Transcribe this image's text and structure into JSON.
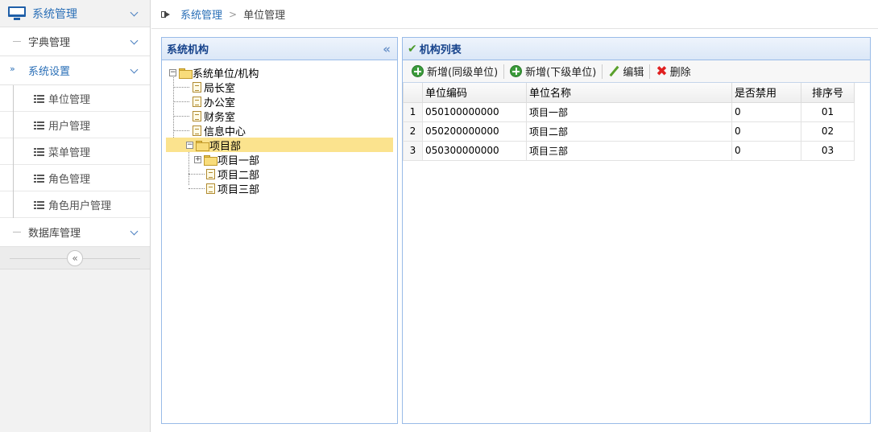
{
  "sidebar": {
    "header_label": "系统管理",
    "groups": [
      {
        "label": "字典管理"
      },
      {
        "label": "系统设置"
      },
      {
        "label": "数据库管理"
      }
    ],
    "items": [
      {
        "label": "单位管理"
      },
      {
        "label": "用户管理"
      },
      {
        "label": "菜单管理"
      },
      {
        "label": "角色管理"
      },
      {
        "label": "角色用户管理"
      }
    ],
    "collapse_glyph": "«",
    "active_marker": "»"
  },
  "breadcrumb": {
    "parent": "系统管理",
    "separator": ">",
    "current": "单位管理"
  },
  "tree_panel": {
    "title": "系统机构",
    "collapse_glyph": "«",
    "nodes": [
      {
        "label": "系统单位/机构",
        "level": 0,
        "type": "folder",
        "expander": "−"
      },
      {
        "label": "局长室",
        "level": 1,
        "type": "doc"
      },
      {
        "label": "办公室",
        "level": 1,
        "type": "doc"
      },
      {
        "label": "财务室",
        "level": 1,
        "type": "doc"
      },
      {
        "label": "信息中心",
        "level": 1,
        "type": "doc"
      },
      {
        "label": "项目部",
        "level": 1,
        "type": "folder",
        "expander": "−",
        "selected": true
      },
      {
        "label": "项目一部",
        "level": 2,
        "type": "folder",
        "expander": "+"
      },
      {
        "label": "项目二部",
        "level": 2,
        "type": "doc"
      },
      {
        "label": "项目三部",
        "level": 2,
        "type": "doc"
      }
    ]
  },
  "list_panel": {
    "title": "机构列表",
    "toolbar": {
      "add_sibling": "新增(同级单位)",
      "add_child": "新增(下级单位)",
      "edit": "编辑",
      "delete": "删除"
    },
    "columns": [
      "单位编码",
      "单位名称",
      "是否禁用",
      "排序号"
    ],
    "rows": [
      {
        "rn": "1",
        "code": "050100000000",
        "name": "项目一部",
        "disabled": "0",
        "order": "01"
      },
      {
        "rn": "2",
        "code": "050200000000",
        "name": "项目二部",
        "disabled": "0",
        "order": "02"
      },
      {
        "rn": "3",
        "code": "050300000000",
        "name": "项目三部",
        "disabled": "0",
        "order": "03"
      }
    ]
  },
  "colors": {
    "accent": "#2a6fb7",
    "panel_border": "#99bbe8",
    "tree_selected": "#fbe38e"
  }
}
